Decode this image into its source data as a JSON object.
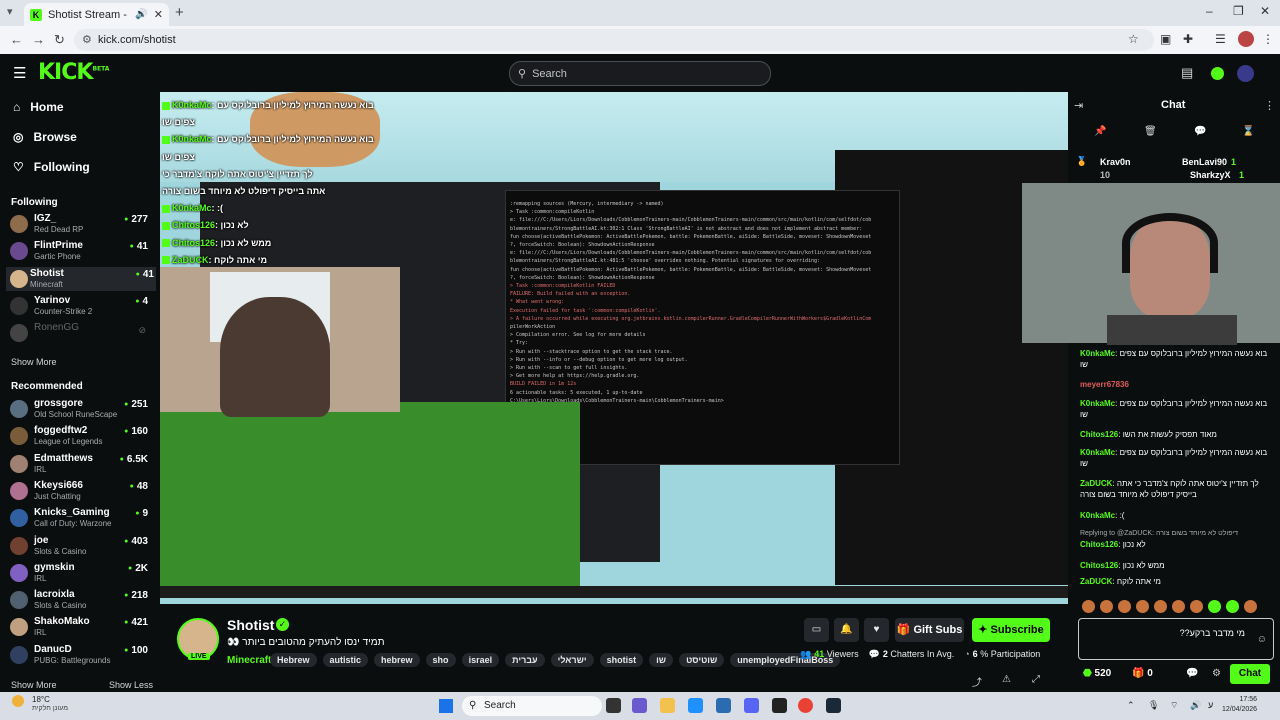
{
  "browser": {
    "tab_title": "Shotist Stream - Watch Live",
    "url": "kick.com/shotist"
  },
  "header": {
    "logo": "KICK",
    "logo_sup": "BETA",
    "search_placeholder": "Search"
  },
  "sidebar": {
    "nav": [
      {
        "label": "Home",
        "icon": "home-icon"
      },
      {
        "label": "Browse",
        "icon": "compass-icon"
      },
      {
        "label": "Following",
        "icon": "heart-icon"
      }
    ],
    "following_title": "Following",
    "following": [
      {
        "name": "IGZ_",
        "game": "Red Dead RP",
        "viewers": "277",
        "color": "#8e6b4a"
      },
      {
        "name": "FlintPrime",
        "game": "Gartic Phone",
        "viewers": "41",
        "color": "#6a4a8e"
      },
      {
        "name": "Shotist",
        "game": "Minecraft",
        "viewers": "41",
        "color": "#d6b48c"
      },
      {
        "name": "Yarinov",
        "game": "Counter-Strike 2",
        "viewers": "4",
        "color": "#333"
      },
      {
        "name": "RonenGG",
        "game": "",
        "viewers": "",
        "color": "#444"
      }
    ],
    "show_more": "Show More",
    "recommended_title": "Recommended",
    "recommended": [
      {
        "name": "grossgore",
        "game": "Old School RuneScape",
        "viewers": "251",
        "color": "#5a6e82"
      },
      {
        "name": "foggedftw2",
        "game": "League of Legends",
        "viewers": "160",
        "color": "#7a5c3a"
      },
      {
        "name": "Edmatthews",
        "game": "IRL",
        "viewers": "6.5K",
        "color": "#a08070"
      },
      {
        "name": "Kkeysi666",
        "game": "Just Chatting",
        "viewers": "48",
        "color": "#b07090"
      },
      {
        "name": "Knicks_Gaming",
        "game": "Call of Duty: Warzone",
        "viewers": "9",
        "color": "#3060a0"
      },
      {
        "name": "joe",
        "game": "Slots & Casino",
        "viewers": "403",
        "color": "#704030"
      },
      {
        "name": "gymskin",
        "game": "IRL",
        "viewers": "2K",
        "color": "#8060c0"
      },
      {
        "name": "lacroixla",
        "game": "Slots & Casino",
        "viewers": "218",
        "color": "#506070"
      },
      {
        "name": "ShakoMako",
        "game": "IRL",
        "viewers": "421",
        "color": "#c0a080"
      },
      {
        "name": "DanucD",
        "game": "PUBG: Battlegrounds",
        "viewers": "100",
        "color": "#304060"
      }
    ],
    "show_more_2": "Show More",
    "show_less": "Show Less"
  },
  "video": {
    "overlay_chat": [
      {
        "user": "K0nkaMc",
        "msg": "בוא נעשה המירוץ למיליון ברובלוקס עם"
      },
      {
        "user": "",
        "msg": "צפים שו"
      },
      {
        "user": "K0nkaMc",
        "msg": "בוא נעשה המירוץ למיליון ברובלוקס עם"
      },
      {
        "user": "",
        "msg": "צפים שו"
      },
      {
        "user": "",
        "msg": "לך תזדיין צ'יטוס אתה לוקח צ'מדבר כי"
      },
      {
        "user": "",
        "msg": "אתה בייסיק דיפולט לא מיוחד בשום צורה"
      },
      {
        "user": "K0nkaMc",
        "msg": ":("
      },
      {
        "user": "Chitos126",
        "msg": "לא נכון"
      },
      {
        "user": "Chitos126",
        "msg": "ממש לא נכון"
      },
      {
        "user": "ZaDUCK",
        "msg": "מי אתה לוקח"
      }
    ],
    "terminal_lines": [
      ":remapping sources (Mercury, intermediary -> named)",
      "> Task :common:compileKotlin",
      "e: file:///C:/Users/Liors/Downloads/CobblemonTrainers-main/CobblemonTrainers-main/common/src/main/kotlin/com/selfdot/cob",
      "blemontrainers/StrongBattleAI.kt:302:1 Class 'StrongBattleAI' is not abstract and does not implement abstract member:",
      "fun choose(activeBattlePokemon: ActiveBattlePokemon, battle: PokemonBattle, aiSide: BattleSide, moveset: ShowdownMoveset",
      "?, forceSwitch: Boolean): ShowdownActionResponse",
      "e: file:///C:/Users/Liors/Downloads/CobblemonTrainers-main/CobblemonTrainers-main/common/src/main/kotlin/com/selfdot/cob",
      "blemontrainers/StrongBattleAI.kt:481:5 'choose' overrides nothing. Potential signatures for overriding:",
      "fun choose(activeBattlePokemon: ActiveBattlePokemon, battle: PokemonBattle, aiSide: BattleSide, moveset: ShowdownMoveset",
      "?, forceSwitch: Boolean): ShowdownActionResponse",
      "> Task :common:compileKotlin FAILED",
      "FAILURE: Build failed with an exception.",
      "* What went wrong:",
      "Execution failed for task ':common:compileKotlin'.",
      "> A failure occurred while executing org.jetbrains.kotlin.compilerRunner.GradleCompilerRunnerWithWorkers$GradleKotlinCom",
      "pilerWorkAction",
      "   > Compilation error. See log for more details",
      "* Try:",
      "> Run with --stacktrace option to get the stack trace.",
      "> Run with --info or --debug option to get more log output.",
      "> Run with --scan to get full insights.",
      "> Get more help at https://help.gradle.org.",
      "BUILD FAILED in 1m 12s",
      "6 actionable tasks: 5 executed, 1 up-to-date",
      "C:\\Users\\Liors\\Downloads\\CobblemonTrainers-main\\CobblemonTrainers-main>"
    ]
  },
  "stream": {
    "name": "Shotist",
    "title": "תמיד ינסו להעתיק מהטובים ביותר 👀",
    "category": "Minecraft",
    "live_label": "LIVE",
    "tags": [
      "Hebrew",
      "autistic",
      "hebrew",
      "sho",
      "israel",
      "עברית",
      "ישראלי",
      "shotist",
      "שו",
      "שוטיסט",
      "unemployedFinalBoss"
    ],
    "gift_label": "Gift Subs",
    "subscribe_label": "Subscribe",
    "viewers_value": "41",
    "viewers_label": "Viewers",
    "chatters_value": "2",
    "chatters_label": "Chatters In Avg.",
    "participation_value": "6",
    "participation_label": "% Participation"
  },
  "chat": {
    "title": "Chat",
    "gifters": [
      {
        "name": "Krav0n",
        "count": "10"
      },
      {
        "name": "BenLavi90",
        "count": "1"
      },
      {
        "name": "SharkzyX",
        "count": "1"
      }
    ],
    "messages": [
      {
        "user": "K0nkaMc",
        "text": "בוא נעשה המירוץ למיליון ברובלוקס עם צפים שו",
        "reply": ""
      },
      {
        "user": "meyerr67836",
        "text": "",
        "reply": ""
      },
      {
        "user": "K0nkaMc",
        "text": "בוא נעשה המירוץ למיליון ברובלוקס עם צפים שו",
        "reply": ""
      },
      {
        "user": "Chitos126",
        "text": "מאוד תפסיק לעשות את השו",
        "reply": ""
      },
      {
        "user": "K0nkaMc",
        "text": "בוא נעשה המירוץ למיליון ברובלוקס עם צפים שו",
        "reply": ""
      },
      {
        "user": "ZaDUCK",
        "text": "לך תזדיין צ'יטוס אתה לוקח צ'מדבר כי אתה בייסיק דיפולט לא מיוחד בשום צורה",
        "reply": ""
      },
      {
        "user": "K0nkaMc",
        "text": ":(",
        "reply": ""
      },
      {
        "user": "Chitos126",
        "text": "לא נכון",
        "reply": "Replying to @ZaDUCK: דיפולט לא מיוחד בשום צורה"
      },
      {
        "user": "Chitos126",
        "text": "ממש לא נכון",
        "reply": ""
      },
      {
        "user": "ZaDUCK",
        "text": "מי אתה לוקח",
        "reply": ""
      }
    ],
    "input_value": "מי מדבר ברקע??",
    "points": "520",
    "points2": "0",
    "send_label": "Chat"
  },
  "taskbar": {
    "temp": "18°C",
    "weather_desc": "מעונן חלקית",
    "search": "Search",
    "time": "17:56",
    "date": "12/04/2026"
  }
}
